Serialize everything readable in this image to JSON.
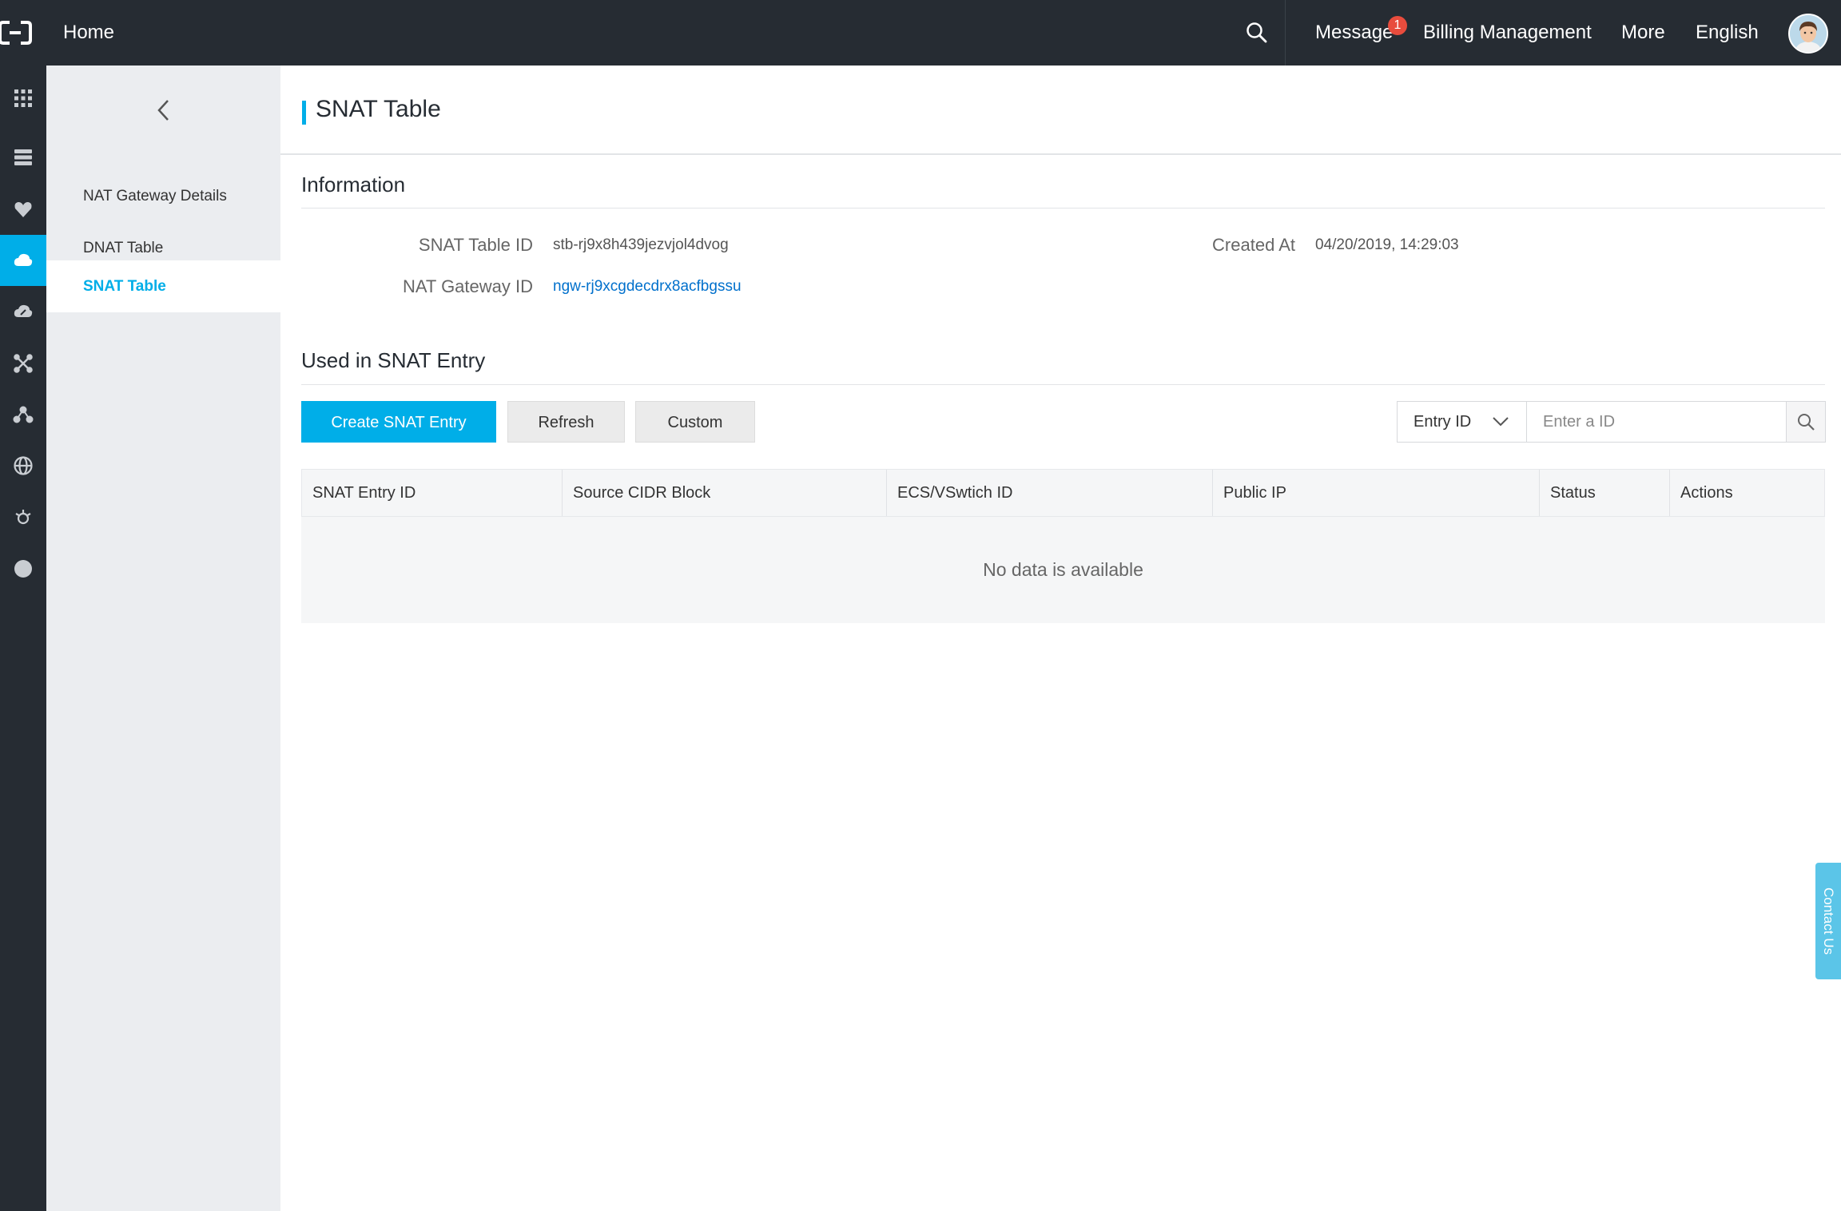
{
  "topbar": {
    "home": "Home",
    "message": "Message",
    "message_badge": "1",
    "billing": "Billing Management",
    "more": "More",
    "language": "English"
  },
  "rail": {
    "icons": [
      "apps-grid-icon",
      "server-icon",
      "heart-shield-icon",
      "cloud-network-icon",
      "cloud-sync-icon",
      "network-nodes-icon",
      "topology-icon",
      "globe-icon",
      "gear-cloud-icon",
      "circle-icon"
    ],
    "active_index": 3,
    "accent_color": "#00aee8"
  },
  "subnav": {
    "items": [
      {
        "label": "NAT Gateway Details"
      },
      {
        "label": "DNAT Table"
      },
      {
        "label": "SNAT Table"
      }
    ],
    "active_index": 2
  },
  "page": {
    "title": "SNAT Table"
  },
  "information": {
    "title": "Information",
    "snat_table_id_label": "SNAT Table ID",
    "snat_table_id": "stb-rj9x8h439jezvjol4dvog",
    "created_at_label": "Created At",
    "created_at": "04/20/2019, 14:29:03",
    "nat_gateway_id_label": "NAT Gateway ID",
    "nat_gateway_id": "ngw-rj9xcgdecdrx8acfbgssu"
  },
  "entries": {
    "title": "Used in SNAT Entry",
    "create_label": "Create SNAT Entry",
    "refresh_label": "Refresh",
    "custom_label": "Custom",
    "filter_select": "Entry ID",
    "filter_placeholder": "Enter a ID",
    "columns": [
      "SNAT Entry ID",
      "Source CIDR Block",
      "ECS/VSwtich ID",
      "Public IP",
      "Status",
      "Actions"
    ],
    "empty_text": "No data is available"
  },
  "contact": "Contact Us"
}
